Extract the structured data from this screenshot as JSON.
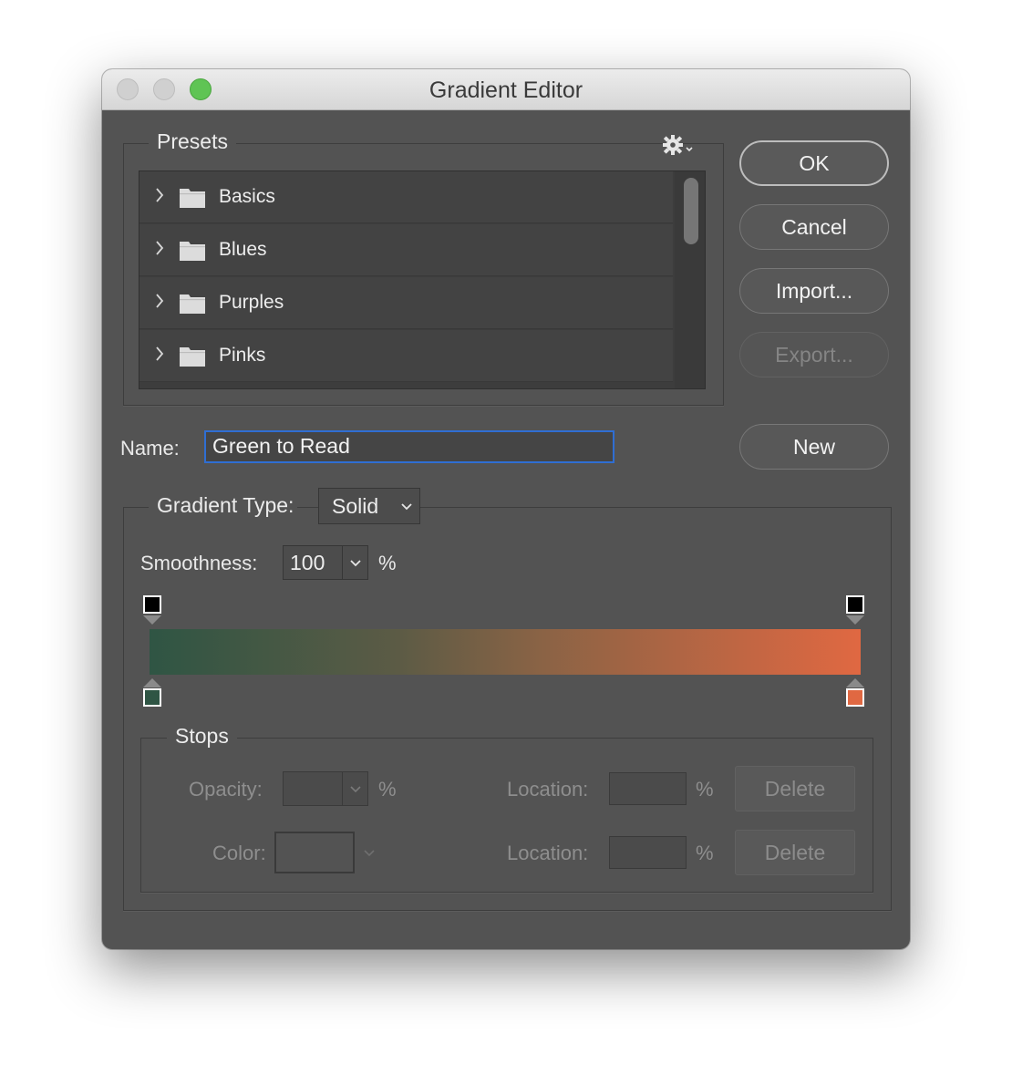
{
  "window": {
    "title": "Gradient Editor"
  },
  "presets": {
    "title": "Presets",
    "folders": [
      {
        "label": "Basics"
      },
      {
        "label": "Blues"
      },
      {
        "label": "Purples"
      },
      {
        "label": "Pinks"
      }
    ]
  },
  "buttons": {
    "ok": "OK",
    "cancel": "Cancel",
    "import": "Import...",
    "export": "Export...",
    "new": "New"
  },
  "name": {
    "label": "Name:",
    "value": "Green to Read"
  },
  "gradient": {
    "type_label": "Gradient Type:",
    "type_value": "Solid",
    "smoothness_label": "Smoothness:",
    "smoothness_value": "100",
    "smoothness_unit": "%",
    "start_color": "#2f5544",
    "end_color": "#e06842",
    "opacity_stops": [
      {
        "location": 0,
        "color": "#000000"
      },
      {
        "location": 100,
        "color": "#000000"
      }
    ],
    "color_stops": [
      {
        "location": 0,
        "color": "#2f5544"
      },
      {
        "location": 100,
        "color": "#e06842"
      }
    ]
  },
  "stops": {
    "title": "Stops",
    "opacity_label": "Opacity:",
    "opacity_unit": "%",
    "location_label": "Location:",
    "location_unit": "%",
    "color_label": "Color:",
    "delete_label": "Delete"
  }
}
